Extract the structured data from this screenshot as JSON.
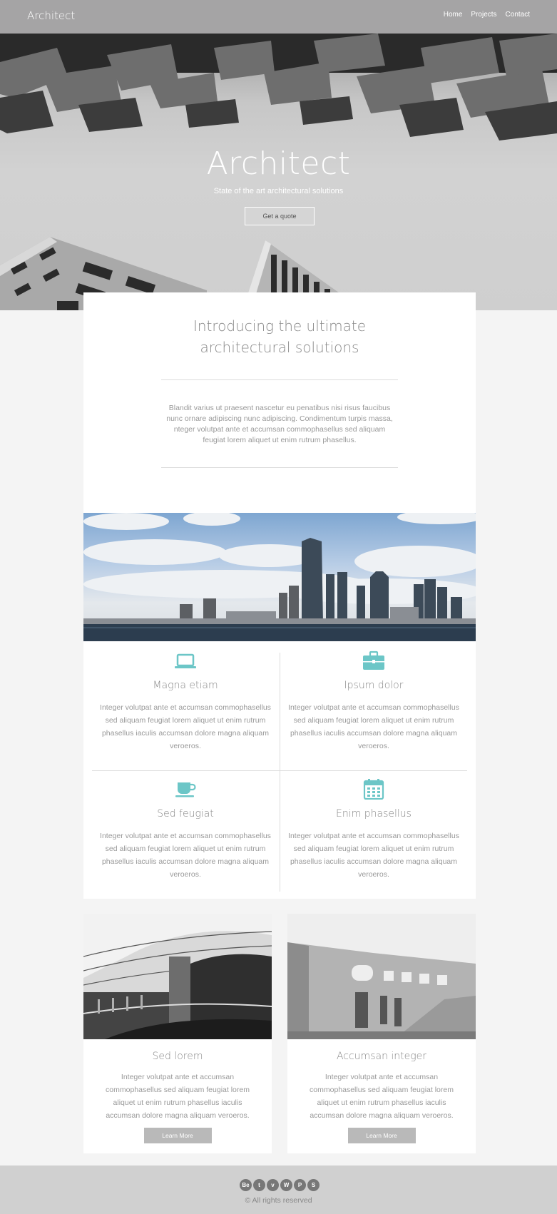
{
  "header": {
    "brand": "Architect",
    "nav": [
      "Home",
      "Projects",
      "Contact"
    ]
  },
  "hero": {
    "title": "Architect",
    "subtitle": "State of the art architectural solutions",
    "button": "Get a quote"
  },
  "intro": {
    "heading": "Introducing the ultimate architectural solutions",
    "body": "Blandit varius ut praesent nascetur eu penatibus nisi risus faucibus nunc ornare adipiscing nunc adipiscing. Condimentum turpis massa, nteger volutpat ante et accumsan commophasellus sed aliquam feugiat lorem aliquet ut enim rutrum phasellus."
  },
  "features": [
    {
      "title": "Magna etiam",
      "icon": "laptop-icon",
      "text": "Integer volutpat ante et accumsan commophasellus sed aliquam feugiat lorem aliquet ut enim rutrum phasellus iaculis accumsan dolore magna aliquam veroeros."
    },
    {
      "title": "Ipsum dolor",
      "icon": "briefcase-icon",
      "text": "Integer volutpat ante et accumsan commophasellus sed aliquam feugiat lorem aliquet ut enim rutrum phasellus iaculis accumsan dolore magna aliquam veroeros."
    },
    {
      "title": "Sed feugiat",
      "icon": "coffee-cup-icon",
      "text": "Integer volutpat ante et accumsan commophasellus sed aliquam feugiat lorem aliquet ut enim rutrum phasellus iaculis accumsan dolore magna aliquam veroeros."
    },
    {
      "title": "Enim phasellus",
      "icon": "calendar-icon",
      "text": "Integer volutpat ante et accumsan commophasellus sed aliquam feugiat lorem aliquet ut enim rutrum phasellus iaculis accumsan dolore magna aliquam veroeros."
    }
  ],
  "cards": [
    {
      "title": "Sed lorem",
      "text": "Integer volutpat ante et accumsan commophasellus sed aliquam feugiat lorem aliquet ut enim rutrum phasellus iaculis accumsan dolore magna aliquam veroeros.",
      "button": "Learn More"
    },
    {
      "title": "Accumsan integer",
      "text": "Integer volutpat ante et accumsan commophasellus sed aliquam feugiat lorem aliquet ut enim rutrum phasellus iaculis accumsan dolore magna aliquam veroeros.",
      "button": "Learn More"
    }
  ],
  "footer": {
    "social": [
      "Be",
      "t",
      "v",
      "W",
      "P",
      "S"
    ],
    "social_icons": [
      "behance-icon",
      "tumblr-icon",
      "vimeo-icon",
      "wordpress-icon",
      "pinterest-icon",
      "skype-icon"
    ],
    "copyright": "© All rights reserved"
  },
  "colors": {
    "accent": "#6cc6c7",
    "header": "#a5a4a5",
    "footer": "#d0d0d0",
    "background": "#f4f4f4"
  }
}
